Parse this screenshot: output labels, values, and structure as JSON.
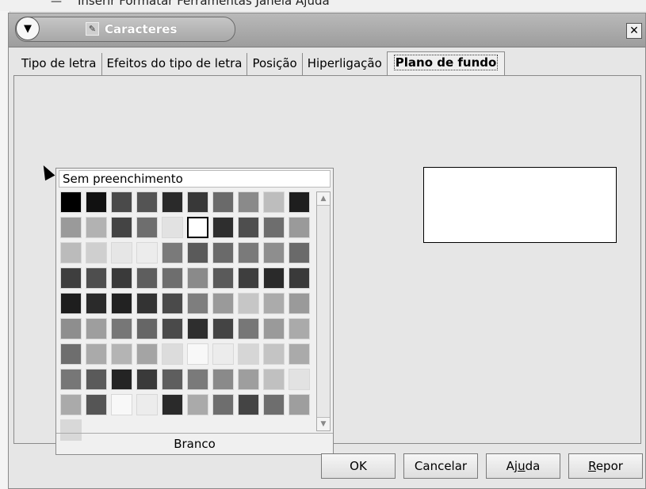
{
  "app_menubar": {
    "text": "Inserir   Formatar   Ferramentas   Janela   Ajuda",
    "dash": "—"
  },
  "dialog": {
    "title": "Caracteres",
    "menu_icon": "chevron-down-icon",
    "close_label": "✕"
  },
  "tabs": [
    {
      "label": "Tipo de letra"
    },
    {
      "label": "Efeitos do tipo de letra"
    },
    {
      "label": "Posição"
    },
    {
      "label": "Hiperligação"
    },
    {
      "label": "Plano de fundo"
    }
  ],
  "active_tab_index": 4,
  "color_chooser": {
    "no_fill_label": "Sem preenchimento",
    "selected_color_name": "Branco",
    "selected_index": 15,
    "colors": [
      "#000000",
      "#111111",
      "#4a4a4a",
      "#545454",
      "#2a2a2a",
      "#383838",
      "#6a6a6a",
      "#8a8a8a",
      "#bdbdbd",
      "#1e1e1e",
      "#9a9a9a",
      "#b2b2b2",
      "#444444",
      "#6e6e6e",
      "#e2e2e2",
      "#ffffff",
      "#2e2e2e",
      "#4e4e4e",
      "#6e6e6e",
      "#9a9a9a",
      "#bbbbbb",
      "#cfcfcf",
      "#e6e6e6",
      "#ececec",
      "#7a7a7a",
      "#5a5a5a",
      "#6a6a6a",
      "#7a7a7a",
      "#8e8e8e",
      "#6a6a6a",
      "#3e3e3e",
      "#4e4e4e",
      "#3a3a3a",
      "#5e5e5e",
      "#6e6e6e",
      "#8a8a8a",
      "#5a5a5a",
      "#3e3e3e",
      "#2a2a2a",
      "#3a3a3a",
      "#1e1e1e",
      "#2a2a2a",
      "#222222",
      "#333333",
      "#4a4a4a",
      "#7e7e7e",
      "#9a9a9a",
      "#c6c6c6",
      "#ababab",
      "#9a9a9a",
      "#8e8e8e",
      "#9e9e9e",
      "#777777",
      "#666666",
      "#4a4a4a",
      "#2e2e2e",
      "#444444",
      "#777777",
      "#9a9a9a",
      "#aaaaaa",
      "#6e6e6e",
      "#aaaaaa",
      "#b4b4b4",
      "#a4a4a4",
      "#dcdcdc",
      "#f8f8f8",
      "#ececec",
      "#d6d6d6",
      "#c4c4c4",
      "#aaaaaa",
      "#777777",
      "#5a5a5a",
      "#242424",
      "#3a3a3a",
      "#5e5e5e",
      "#7a7a7a",
      "#8a8a8a",
      "#9e9e9e",
      "#c0c0c0",
      "#e2e2e2",
      "#aaaaaa",
      "#555555",
      "#f8f8f8",
      "#ececec",
      "#2a2a2a",
      "#aaaaaa",
      "#6e6e6e",
      "#444444",
      "#6e6e6e",
      "#9e9e9e",
      "#d8d8d8"
    ]
  },
  "buttons": {
    "ok": "OK",
    "cancel": "Cancelar",
    "help_pre": "Aj",
    "help_u": "u",
    "help_post": "da",
    "reset_u": "R",
    "reset_post": "epor"
  }
}
